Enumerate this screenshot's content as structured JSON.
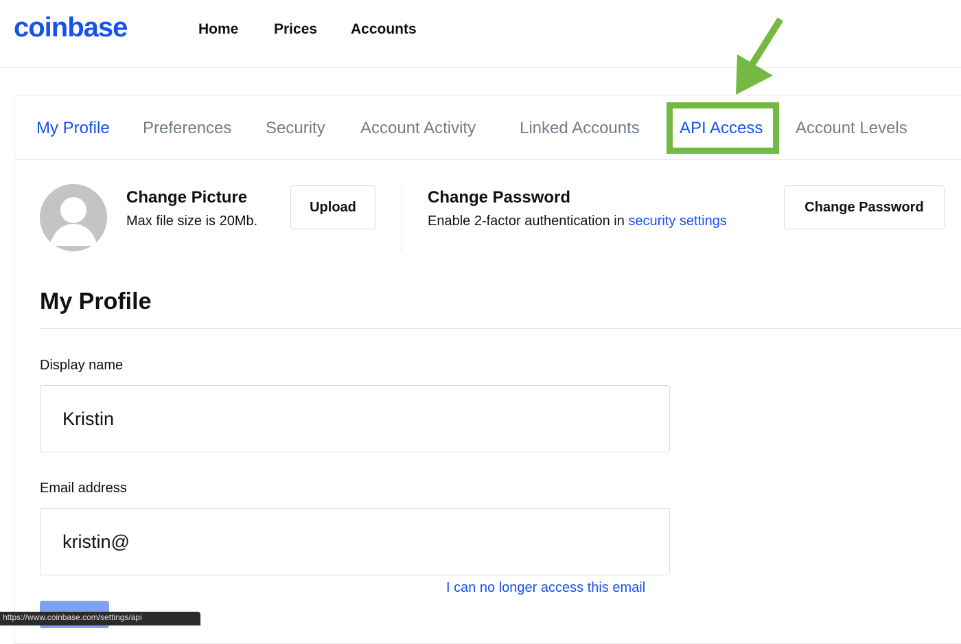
{
  "header": {
    "logo": "coinbase",
    "nav": [
      "Home",
      "Prices",
      "Accounts"
    ]
  },
  "tabs": [
    {
      "label": "My Profile",
      "active": true
    },
    {
      "label": "Preferences",
      "active": false
    },
    {
      "label": "Security",
      "active": false
    },
    {
      "label": "Account Activity",
      "active": false
    },
    {
      "label": "Linked Accounts",
      "active": false
    },
    {
      "label": "API Access",
      "active": false,
      "highlighted": true
    },
    {
      "label": "Account Levels",
      "active": false
    }
  ],
  "picture": {
    "title": "Change Picture",
    "subtitle": "Max file size is 20Mb.",
    "button": "Upload"
  },
  "password": {
    "title": "Change Password",
    "subtitle_prefix": "Enable 2-factor authentication in ",
    "subtitle_link": "security settings",
    "button": "Change Password"
  },
  "profile": {
    "section_title": "My Profile",
    "display_name_label": "Display name",
    "display_name_value": "Kristin",
    "email_label": "Email address",
    "email_value": "kristin@",
    "email_link": "I can no longer access this email"
  },
  "status_bar": {
    "url": "https://www.coinbase.com/settings/api"
  },
  "colors": {
    "brand": "#1652f0",
    "highlight": "#74b943",
    "muted_tab": "#6f7d8c"
  }
}
